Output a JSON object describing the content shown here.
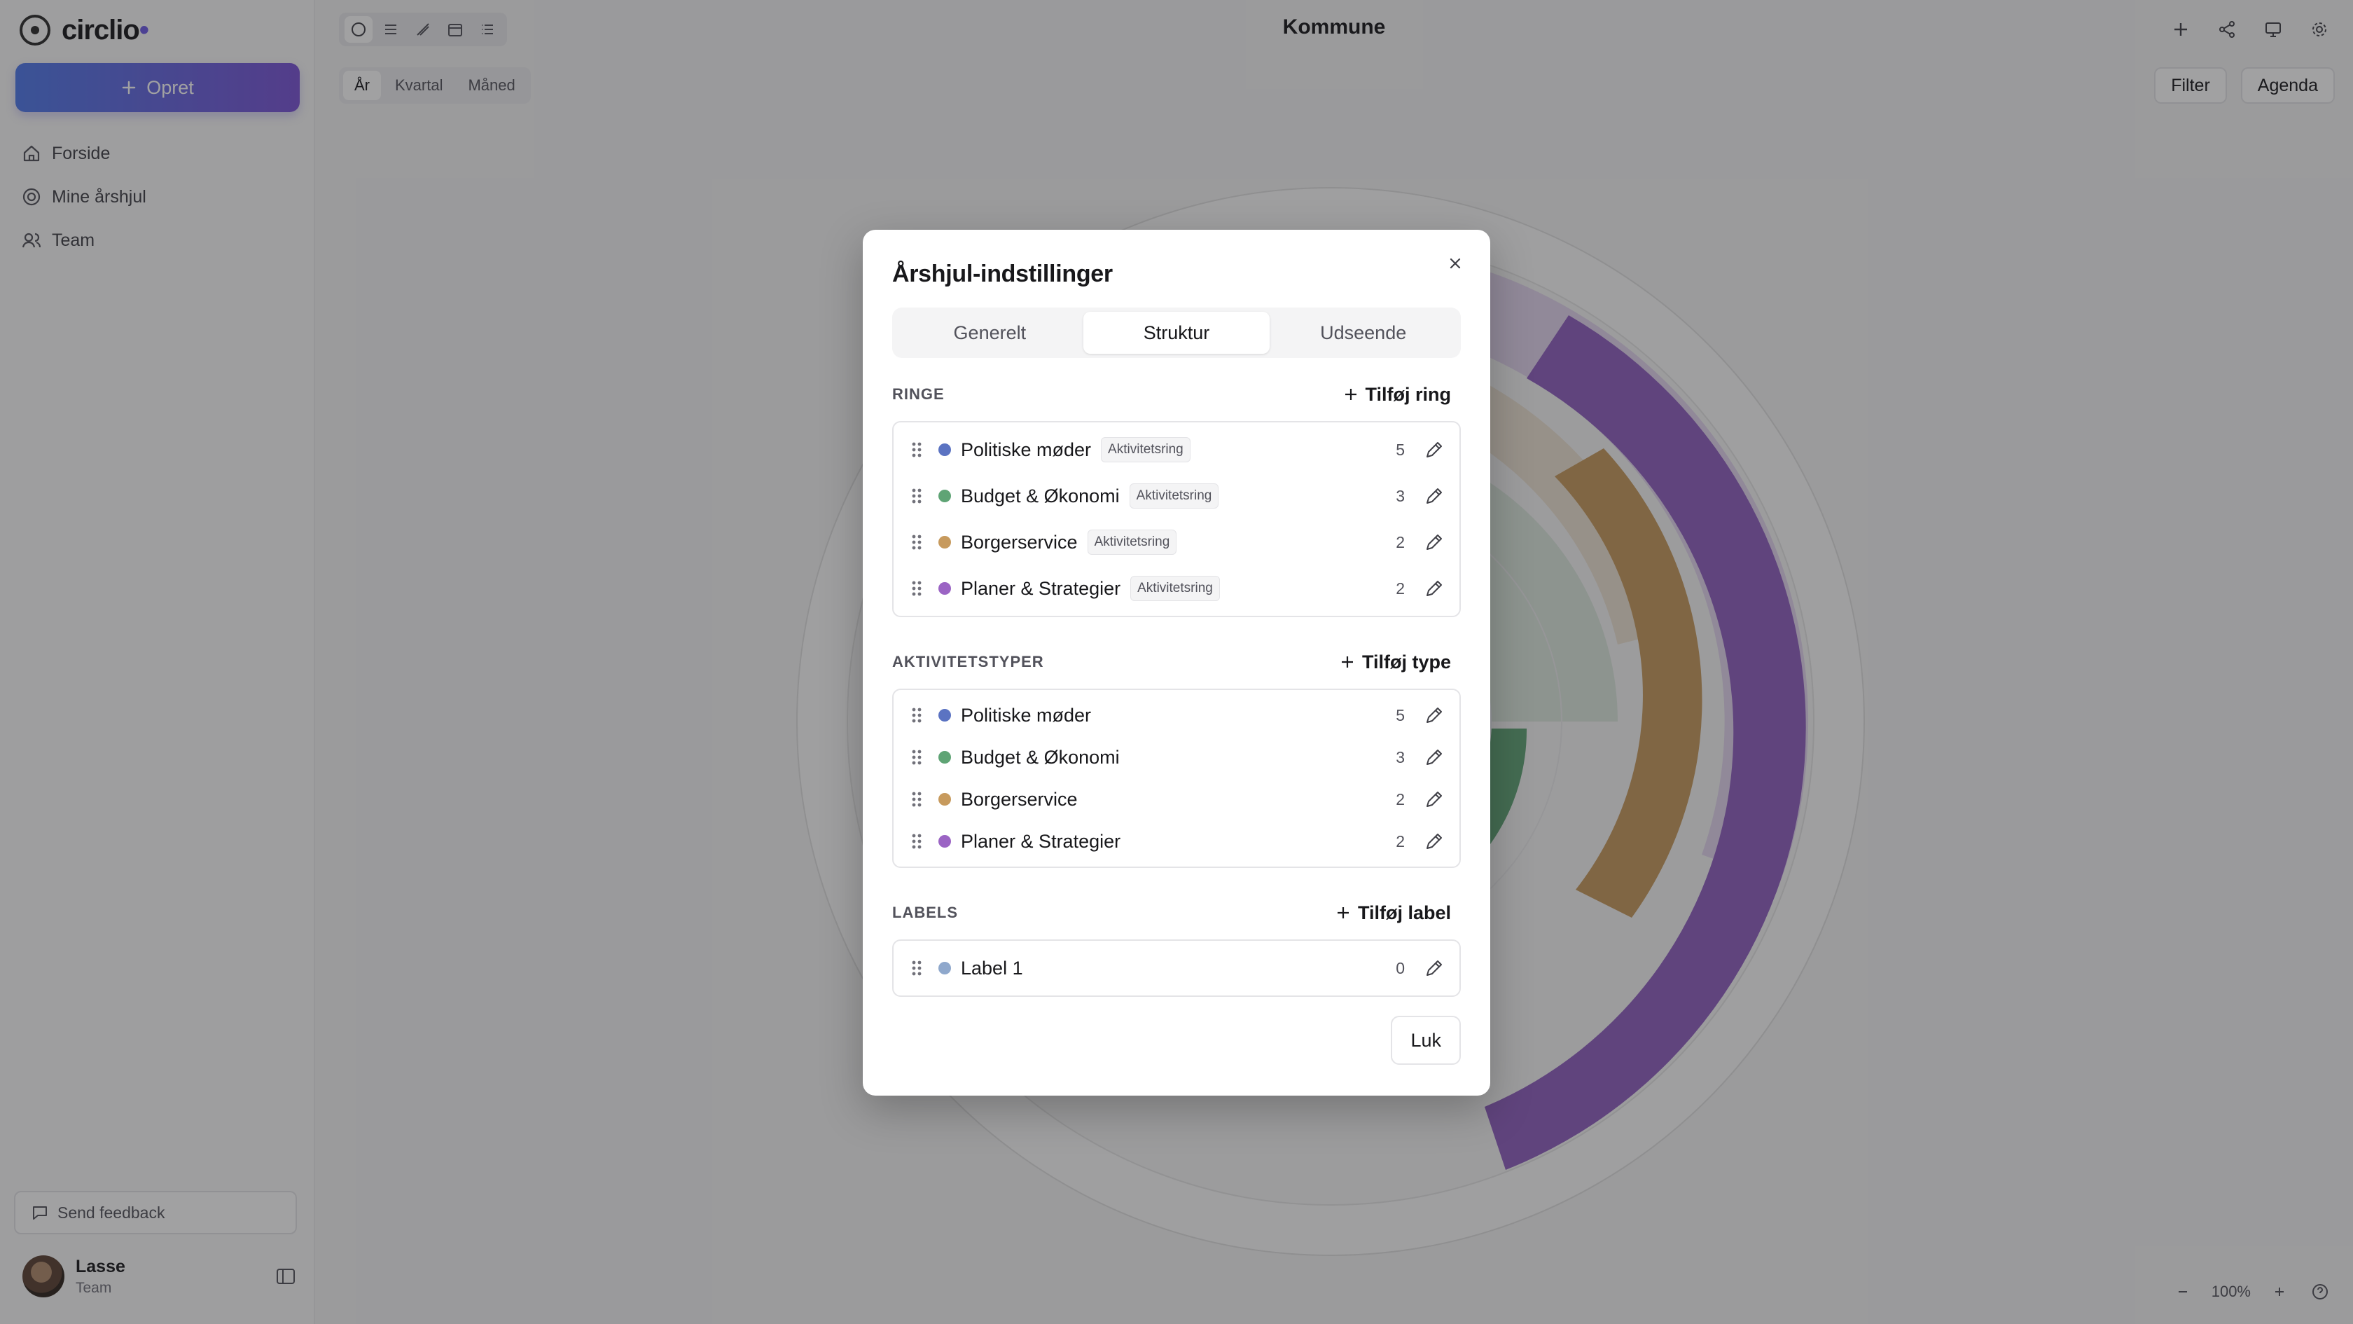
{
  "sidebar": {
    "brand": "circlio",
    "brand_dot": "•",
    "create_label": "Opret",
    "nav": [
      {
        "label": "Forside",
        "icon": "home-icon"
      },
      {
        "label": "Mine årshjul",
        "icon": "circle-icon"
      },
      {
        "label": "Team",
        "icon": "users-icon"
      }
    ],
    "feedback_label": "Send feedback",
    "user": {
      "name": "Lasse",
      "role": "Team"
    }
  },
  "header": {
    "title": "Kommune",
    "period_tabs": [
      "År",
      "Kvartal",
      "Måned"
    ],
    "active_period": "År",
    "filter_label": "Filter",
    "agenda_label": "Agenda"
  },
  "zoom": {
    "level": "100%"
  },
  "modal": {
    "title": "Årshjul-indstillinger",
    "tabs": [
      "Generelt",
      "Struktur",
      "Udseende"
    ],
    "active_tab": "Struktur",
    "rings": {
      "title": "RINGE",
      "add_label": "Tilføj ring",
      "items": [
        {
          "name": "Politiske møder",
          "tag": "Aktivitetsring",
          "count": "5",
          "color": "#5b73c2"
        },
        {
          "name": "Budget & Økonomi",
          "tag": "Aktivitetsring",
          "count": "3",
          "color": "#5fa475"
        },
        {
          "name": "Borgerservice",
          "tag": "Aktivitetsring",
          "count": "2",
          "color": "#c79a5d"
        },
        {
          "name": "Planer & Strategier",
          "tag": "Aktivitetsring",
          "count": "2",
          "color": "#9b64c4"
        }
      ]
    },
    "types": {
      "title": "AKTIVITETSTYPER",
      "add_label": "Tilføj type",
      "items": [
        {
          "name": "Politiske møder",
          "count": "5",
          "color": "#5b73c2"
        },
        {
          "name": "Budget & Økonomi",
          "count": "3",
          "color": "#5fa475"
        },
        {
          "name": "Borgerservice",
          "count": "2",
          "color": "#c79a5d"
        },
        {
          "name": "Planer & Strategier",
          "count": "2",
          "color": "#9b64c4"
        }
      ]
    },
    "labels": {
      "title": "LABELS",
      "add_label": "Tilføj label",
      "items": [
        {
          "name": "Label 1",
          "count": "0",
          "color": "#8fa8cc"
        }
      ]
    },
    "close_label": "Luk"
  }
}
